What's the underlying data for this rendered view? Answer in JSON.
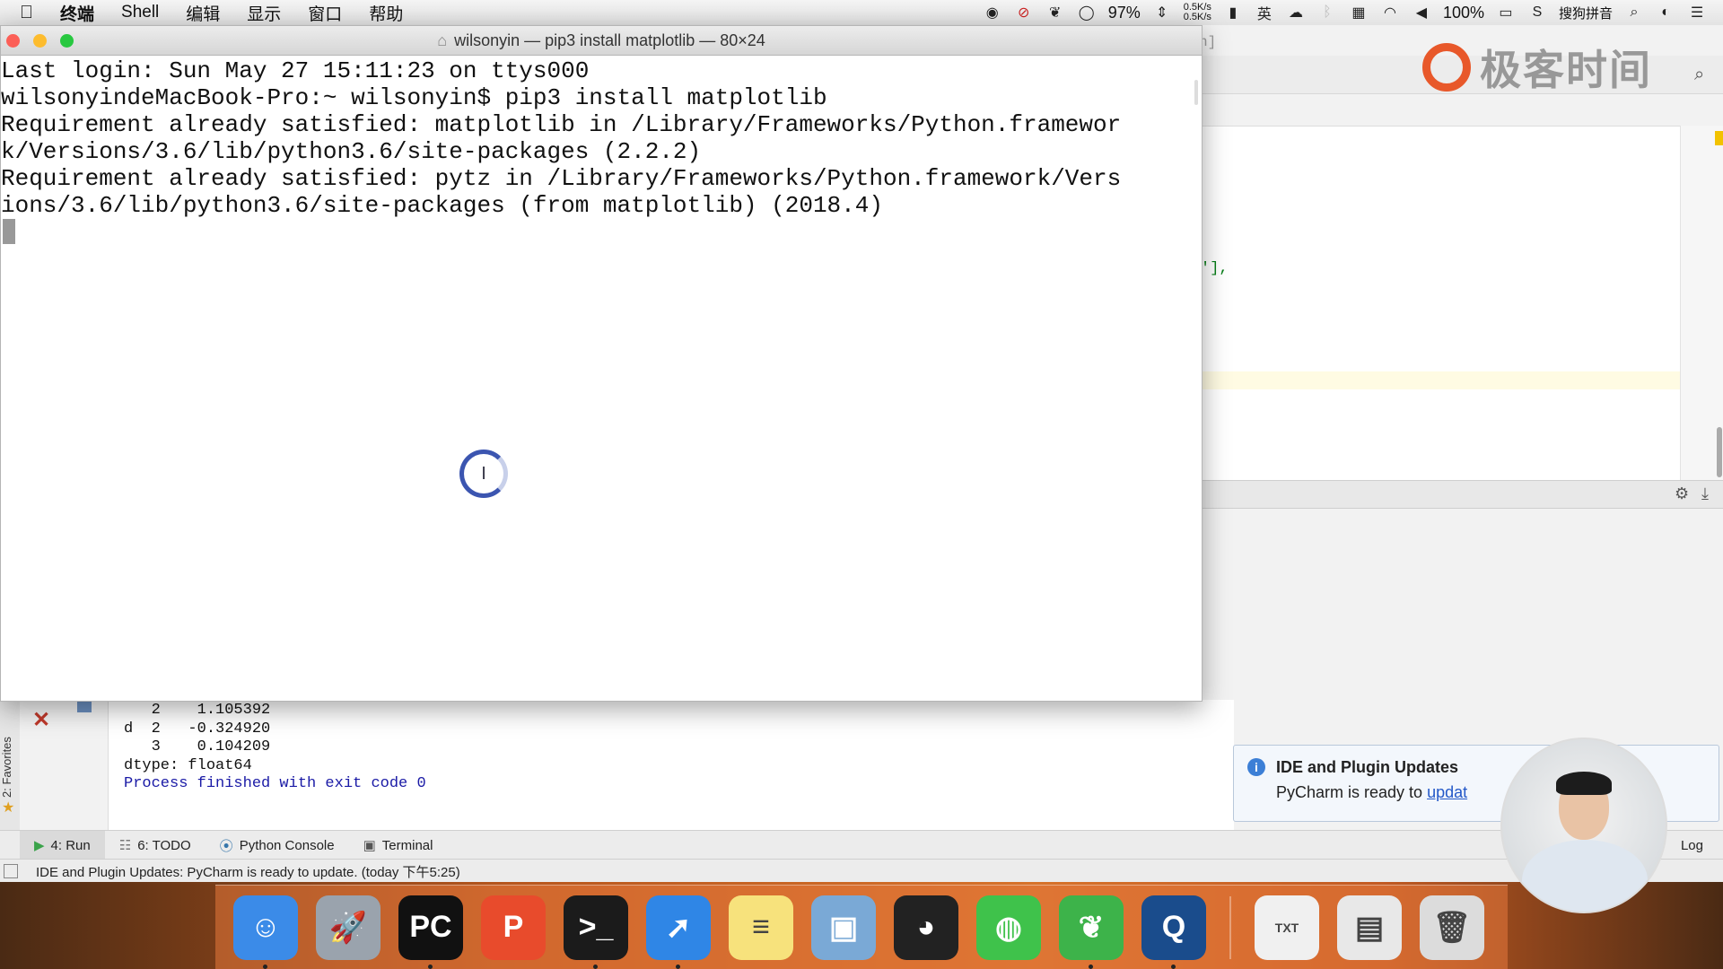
{
  "menubar": {
    "apple": "",
    "items": [
      "终端",
      "Shell",
      "编辑",
      "显示",
      "窗口",
      "帮助"
    ],
    "battery_percent": "97%",
    "net_up": "0.5K/s",
    "net_down": "0.5K/s",
    "battery2_percent": "100%",
    "ime": "搜狗拼音"
  },
  "terminal": {
    "title": "wilsonyin — pip3 install matplotlib — 80×24",
    "lines": [
      "Last login: Sun May 27 15:11:23 on ttys000",
      "wilsonyindeMacBook-Pro:~ wilsonyin$ pip3 install matplotlib",
      "Requirement already satisfied: matplotlib in /Library/Frameworks/Python.framewor",
      "k/Versions/3.6/lib/python3.6/site-packages (2.2.2)",
      "Requirement already satisfied: pytz in /Library/Frameworks/Python.framework/Vers",
      "ions/3.6/lib/python3.6/site-packages (from matplotlib) (2018.4)"
    ]
  },
  "ide": {
    "window_tab_fragment": "n]",
    "code_fragment": "'],",
    "run_output": [
      "   2    1.105392",
      "d  2   -0.324920",
      "   3    0.104209",
      "dtype: float64",
      "",
      "Process finished with exit code 0"
    ],
    "favorites_label": "2: Favorites",
    "tabs": [
      {
        "label": "4: Run"
      },
      {
        "label": "6: TODO"
      },
      {
        "label": "Python Console"
      },
      {
        "label": "Terminal"
      }
    ],
    "event_log": "Log",
    "status_text": "IDE and Plugin Updates: PyCharm is ready to update. (today 下午5:25)"
  },
  "notification": {
    "title": "IDE and Plugin Updates",
    "body_prefix": "PyCharm is ready to ",
    "link": "updat"
  },
  "brand": {
    "text": "极客时间"
  },
  "dock": {
    "items": [
      {
        "name": "Finder",
        "glyph": "☺",
        "color": "#3b8be8"
      },
      {
        "name": "Launchpad",
        "glyph": "🚀",
        "color": "#9aa3ad"
      },
      {
        "name": "PyCharm",
        "glyph": "PC",
        "color": "#111111"
      },
      {
        "name": "WPS",
        "glyph": "P",
        "color": "#e84b2c"
      },
      {
        "name": "Terminal",
        "glyph": ">_",
        "color": "#1b1b1b"
      },
      {
        "name": "Safari",
        "glyph": "➚",
        "color": "#2f86e6"
      },
      {
        "name": "Notes",
        "glyph": "≡",
        "color": "#f7e27c"
      },
      {
        "name": "Preview",
        "glyph": "▣",
        "color": "#7aa9d6"
      },
      {
        "name": "QQ",
        "glyph": "◕",
        "color": "#222222"
      },
      {
        "name": "WeChat",
        "glyph": "◍",
        "color": "#3fc24b"
      },
      {
        "name": "Evernote",
        "glyph": "❦",
        "color": "#3db34a"
      },
      {
        "name": "QuickTime",
        "glyph": "Q",
        "color": "#1a4c8c"
      }
    ],
    "extras": [
      {
        "name": "TXT document",
        "glyph": "TXT",
        "color": "#f0f0f0"
      },
      {
        "name": "Screenshot",
        "glyph": "▤",
        "color": "#e8e8e8"
      },
      {
        "name": "Trash",
        "glyph": "🗑",
        "color": "#dcdcdc"
      }
    ]
  }
}
